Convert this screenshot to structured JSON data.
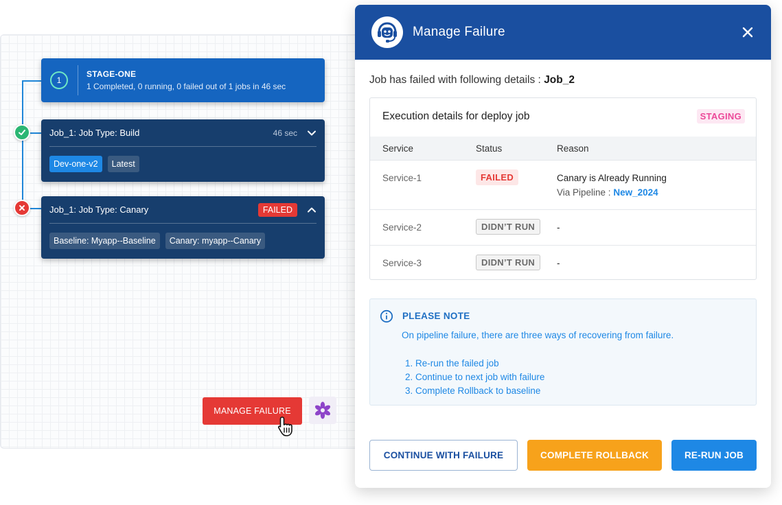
{
  "pipeline": {
    "stage": {
      "number": "1",
      "title": "STAGE-ONE",
      "summary": "1 Completed, 0 running, 0 failed out of 1 jobs in 46 sec"
    },
    "jobs": [
      {
        "title": "Job_1: Job Type: Build",
        "time": "46 sec",
        "status": "success",
        "tags": [
          "Dev-one-v2",
          "Latest"
        ]
      },
      {
        "title": "Job_1: Job Type: Canary",
        "badge": "FAILED",
        "status": "failed",
        "tags": [
          "Baseline: Myapp--Baseline",
          "Canary: myapp--Canary"
        ]
      }
    ],
    "manage_failure_label": "MANAGE FAILURE"
  },
  "modal": {
    "title": "Manage Failure",
    "fail_prefix": "Job has failed with following details :",
    "fail_job": "Job_2",
    "execution": {
      "title": "Execution details for deploy job",
      "env_badge": "STAGING",
      "columns": [
        "Service",
        "Status",
        "Reason"
      ],
      "rows": [
        {
          "service": "Service-1",
          "status": "FAILED",
          "reason": "Canary is Already Running",
          "via_label": "Via Pipeline :",
          "via_link": "New_2024"
        },
        {
          "service": "Service-2",
          "status": "DIDN’T RUN",
          "reason": "-"
        },
        {
          "service": "Service-3",
          "status": "DIDN’T RUN",
          "reason": "-"
        }
      ]
    },
    "note": {
      "title": "PLEASE NOTE",
      "text": "On pipeline failure, there are three ways of recovering from failure.",
      "items": [
        "1. Re-run the failed job",
        "2. Continue to next job with failure",
        "3. Complete Rollback to baseline"
      ]
    },
    "buttons": {
      "continue": "CONTINUE WITH FAILURE",
      "rollback": "COMPLETE ROLLBACK",
      "rerun": "RE-RUN JOB"
    }
  },
  "colors": {
    "header_blue": "#1a4fa0",
    "stage_blue": "#1565c0",
    "job_navy": "#173e6d",
    "danger_red": "#e53935",
    "rollback_orange": "#f7a21b",
    "link_blue": "#1e88e5",
    "staging_pink": "#ec4899"
  },
  "icons": [
    "check-icon",
    "error-x-icon",
    "chevron-down-icon",
    "chevron-up-icon",
    "bot-support-icon",
    "close-icon",
    "info-icon",
    "flower-icon",
    "hand-cursor-icon"
  ]
}
